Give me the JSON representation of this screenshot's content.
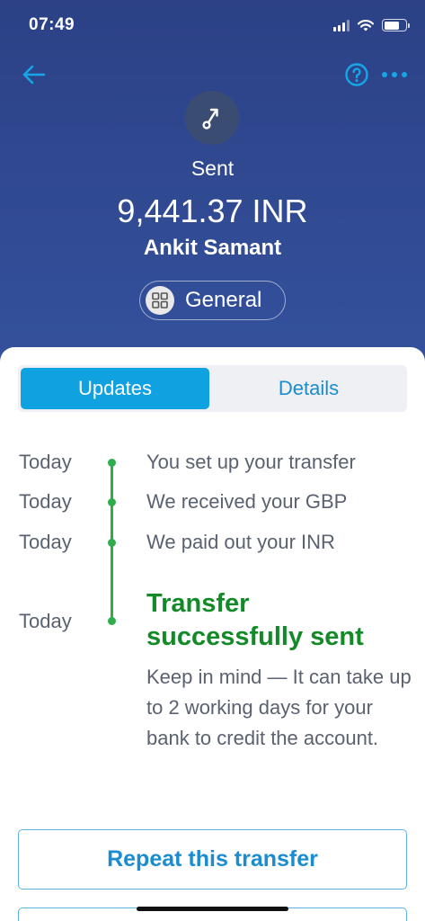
{
  "status_bar": {
    "time": "07:49"
  },
  "header": {
    "back_icon": "arrow-left-icon",
    "help_icon": "question-circle-icon",
    "more_icon": "ellipsis-icon",
    "status_icon": "sent-arrow-icon",
    "status_label": "Sent",
    "amount": "9,441.37 INR",
    "recipient": "Ankit Samant",
    "category": {
      "icon": "grid-icon",
      "label": "General"
    }
  },
  "tabs": [
    {
      "label": "Updates",
      "active": true
    },
    {
      "label": "Details",
      "active": false
    }
  ],
  "timeline": [
    {
      "date": "Today",
      "text": "You set up your transfer"
    },
    {
      "date": "Today",
      "text": "We received your GBP"
    },
    {
      "date": "Today",
      "text": "We paid out your INR"
    },
    {
      "date": "Today",
      "title": "Transfer successfully sent",
      "note": "Keep in mind — It can take up to 2 working days for your bank to credit the account."
    }
  ],
  "actions": {
    "repeat_label": "Repeat this transfer"
  },
  "colors": {
    "header_bg": "#2f468e",
    "accent_blue": "#10a1e1",
    "success_green": "#138a28",
    "timeline_green": "#2fad4a"
  }
}
